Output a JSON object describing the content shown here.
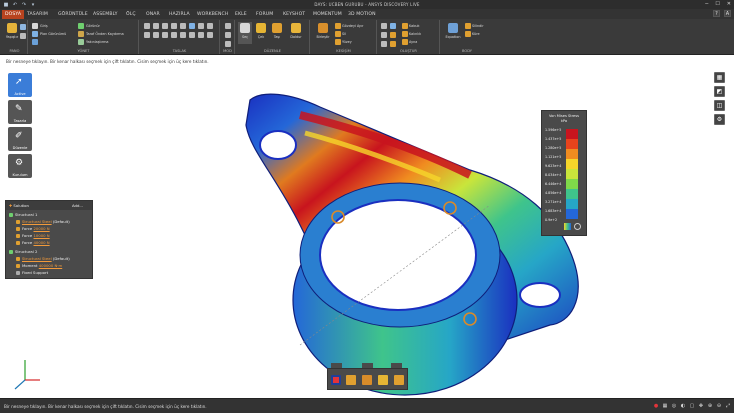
{
  "window": {
    "title": "DAYS: UCBEN GURUBU - ANSYS DISCOVERY LIVE",
    "quick_access": [
      "save-icon",
      "undo-icon",
      "redo-icon",
      "dropdown-icon"
    ],
    "controls": [
      "minimize-icon",
      "maximize-icon",
      "close-icon"
    ]
  },
  "menu": {
    "tabs": [
      "DOSYA",
      "TASARIM",
      "GÖRÜNTÜLE",
      "ASSEMBLY",
      "ÖLÇ",
      "ONAR",
      "HAZIRLA",
      "WORKBENCH",
      "EKLE",
      "FORUM",
      "KEYSHOT",
      "MOMENTUM",
      "3D MOTION"
    ],
    "active_tab": "DOSYA"
  },
  "ribbon": {
    "groups": {
      "pano": {
        "label": "PANO",
        "btn1": "Yapıştır"
      },
      "yonet": {
        "label": "YÖNET",
        "items": [
          "Giriş",
          "Plan Görünümü",
          "Yakın Yakınlaştır",
          "Görünür",
          "Taraf Önden Kaydırma",
          "Yakınlaştırma"
        ]
      },
      "taslak": {
        "label": "TASLAK"
      },
      "mod": {
        "label": "MOD",
        "btn1": "Seç"
      },
      "duzenle": {
        "label": "DÜZENLE",
        "items": [
          "Çek",
          "Taşı",
          "Doldur"
        ]
      },
      "kesisim": {
        "label": "KESİŞİM",
        "btn1": "Birleştir",
        "items": [
          "Gövdeyi Ayır",
          "Sil",
          "Yüzey"
        ]
      },
      "olustur": {
        "label": "OLUŞTUR",
        "items": [
          "Kabuk",
          "Kalınlık",
          "Ayna"
        ]
      },
      "body": {
        "label": "BODY",
        "btn1": "Equation",
        "items": [
          "Silindir",
          "Küre"
        ]
      }
    }
  },
  "viewport": {
    "hint": "Bir nesneye tıklayın. Bir kenar halkası seçmek için çift tıklatın. Cisim seçmek için üç kere tıklatın.",
    "tools": [
      {
        "label": "Active",
        "icon": "cursor-icon"
      },
      {
        "label": "Tasarla",
        "icon": "pencil-icon"
      },
      {
        "label": "Düzenle",
        "icon": "brush-icon"
      },
      {
        "label": "Kurulum",
        "icon": "setup-icon"
      }
    ]
  },
  "tree": {
    "header": {
      "solution": "Solution",
      "add": "Add..."
    },
    "rows": [
      {
        "text": "Structural 1",
        "level": 0
      },
      {
        "text": "Structural Steel",
        "suffix": "(Default)",
        "level": 1,
        "link": true
      },
      {
        "text": "Force",
        "value": "20000 N",
        "level": 1
      },
      {
        "text": "Force",
        "value": "10000 N",
        "level": 1
      },
      {
        "text": "Force",
        "value": "40000 N",
        "level": 1
      },
      {
        "text": "Structural 2",
        "level": 0
      },
      {
        "text": "Structural Steel",
        "suffix": "(Default)",
        "level": 1,
        "link": true
      },
      {
        "text": "Moment",
        "value": "400000 N·m",
        "level": 1
      },
      {
        "text": "Fixed Support",
        "level": 1
      }
    ]
  },
  "legend": {
    "title": "Von Mises Stress",
    "unit": "kPa",
    "ticks": [
      "1.596e+5",
      "1.437e+5",
      "1.280e+5",
      "1.121e+5",
      "9.623e+4",
      "8.034e+4",
      "6.446e+4",
      "4.856e+4",
      "3.271e+4",
      "1.683e+4",
      "0.9e+2"
    ],
    "colors": [
      "#c8141e",
      "#e8431c",
      "#f08c20",
      "#f6d62a",
      "#c9e53b",
      "#7fd94a",
      "#3fc48b",
      "#26a6c7",
      "#2467d8",
      "#1a2fc0"
    ]
  },
  "right_icons": [
    "display-icon",
    "color-icon",
    "panel-icon",
    "settings-icon"
  ],
  "bottom_toolbar": [
    "stop-icon",
    "rotate-icon",
    "cube-icon",
    "box-icon",
    "chart-icon"
  ],
  "status": {
    "text": "Bir nesneye tıklayın. Bir kenar halkası seçmek için çift tıklatın. Cisim seçmek için üç kere tıklatın."
  }
}
